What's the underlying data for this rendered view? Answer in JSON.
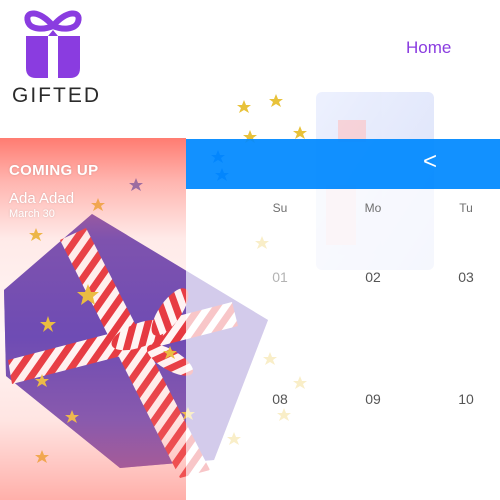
{
  "brand": {
    "name": "GIFTED",
    "logo_icon": "gift-icon",
    "color": "#8a3ce0"
  },
  "nav": {
    "home_label": "Home"
  },
  "coming_up": {
    "heading": "COMING UP",
    "person_name": "Ada Adad",
    "date": "March 30"
  },
  "calendar": {
    "prev_icon": "chevron-left-icon",
    "prev_label": "<",
    "header_color": "#0089ff",
    "weekdays": [
      "Su",
      "Mo",
      "Tu"
    ],
    "rows": [
      [
        "01",
        "02",
        "03"
      ],
      [
        "08",
        "09",
        "10"
      ]
    ]
  }
}
